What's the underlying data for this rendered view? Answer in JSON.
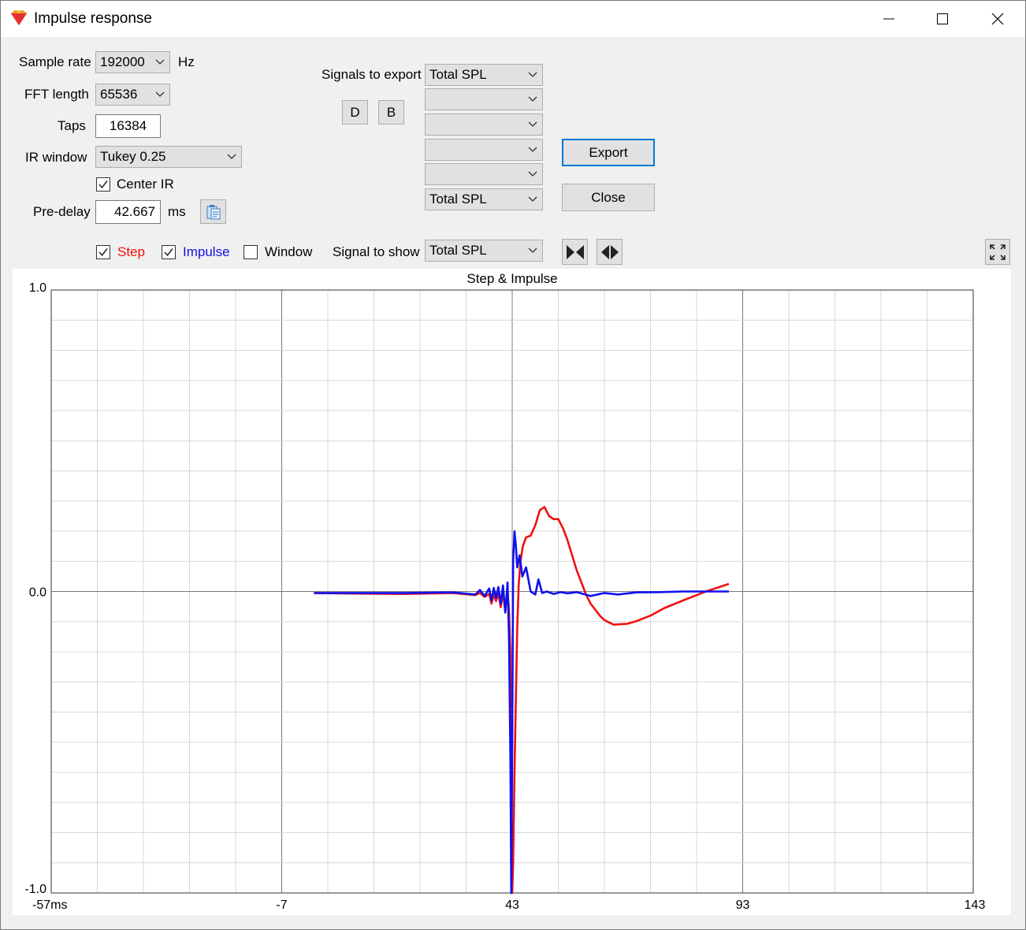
{
  "window": {
    "title": "Impulse response",
    "icon": "ruby-logo-icon"
  },
  "settings": {
    "sample_rate_label": "Sample rate",
    "sample_rate_value": "192000",
    "sample_rate_unit": "Hz",
    "fft_length_label": "FFT length",
    "fft_length_value": "65536",
    "taps_label": "Taps",
    "taps_value": "16384",
    "ir_window_label": "IR window",
    "ir_window_value": "Tukey 0.25",
    "center_ir_label": "Center IR",
    "center_ir_checked": true,
    "predelay_label": "Pre-delay",
    "predelay_value": "42.667",
    "predelay_unit": "ms"
  },
  "export": {
    "signals_label": "Signals to export",
    "signals": [
      "Total SPL",
      "",
      "",
      "",
      "",
      "Total SPL"
    ],
    "d_label": "D",
    "b_label": "B",
    "export_label": "Export",
    "close_label": "Close"
  },
  "display": {
    "step_label": "Step",
    "step_checked": true,
    "impulse_label": "Impulse",
    "impulse_checked": true,
    "window_label": "Window",
    "window_checked": false,
    "signal_show_label": "Signal to show",
    "signal_show_value": "Total SPL"
  },
  "colors": {
    "step": "#ee1111",
    "impulse": "#1010ee",
    "accent": "#0078d7"
  },
  "chart_data": {
    "type": "line",
    "title": "Step & Impulse",
    "xlabel": "",
    "ylabel": "",
    "xlim": [
      -57,
      143
    ],
    "ylim": [
      -1.0,
      1.0
    ],
    "x_tick_labels": [
      "-57ms",
      "-7",
      "43",
      "93",
      "143"
    ],
    "x_ticks": [
      -57,
      -7,
      43,
      93,
      143
    ],
    "y_tick_labels": [
      "1.0",
      "0.0",
      "-1.0"
    ],
    "y_ticks": [
      1.0,
      0.0,
      -1.0
    ],
    "grid": true,
    "series": [
      {
        "name": "Step",
        "color": "#ee1111",
        "x": [
          0.0,
          10,
          20,
          30,
          35,
          36,
          37,
          38,
          38.5,
          39,
          39.5,
          40,
          40.5,
          41,
          41.5,
          42,
          42.3,
          42.6,
          42.8,
          43.0,
          43.2,
          43.5,
          43.8,
          44.1,
          44.4,
          44.8,
          45.3,
          46,
          47,
          48,
          49,
          50,
          51,
          52,
          53,
          54,
          55,
          56,
          57,
          58,
          59,
          60,
          61,
          62,
          63,
          65,
          68,
          70,
          73,
          76,
          80,
          85,
          90
        ],
        "y": [
          -0.005,
          -0.007,
          -0.008,
          -0.005,
          -0.012,
          -0.005,
          -0.018,
          -0.008,
          -0.04,
          -0.01,
          -0.032,
          -0.005,
          -0.052,
          -0.005,
          -0.065,
          0.0,
          -0.06,
          -0.2,
          -0.6,
          -1.0,
          -0.9,
          -0.6,
          -0.35,
          -0.12,
          0.02,
          0.1,
          0.15,
          0.18,
          0.185,
          0.22,
          0.27,
          0.28,
          0.25,
          0.24,
          0.24,
          0.21,
          0.17,
          0.12,
          0.07,
          0.03,
          -0.01,
          -0.04,
          -0.06,
          -0.08,
          -0.095,
          -0.11,
          -0.107,
          -0.098,
          -0.08,
          -0.055,
          -0.03,
          0.0,
          0.025
        ]
      },
      {
        "name": "Impulse",
        "color": "#1010ee",
        "x": [
          0.0,
          10,
          20,
          30,
          35,
          36,
          37,
          38,
          38.5,
          39,
          39.5,
          40,
          40.5,
          41,
          41.5,
          42,
          42.3,
          42.6,
          42.8,
          43.0,
          43.2,
          43.5,
          43.8,
          44.1,
          44.6,
          45.2,
          46,
          47,
          48,
          48.7,
          49.5,
          50.5,
          52,
          53.5,
          55,
          57,
          60,
          63,
          66,
          70,
          75,
          80,
          85,
          90
        ],
        "y": [
          -0.005,
          -0.005,
          -0.005,
          -0.003,
          -0.01,
          0.005,
          -0.015,
          0.01,
          -0.03,
          0.012,
          -0.02,
          0.015,
          -0.04,
          0.02,
          -0.07,
          0.03,
          -0.15,
          -0.55,
          -1.0,
          -0.5,
          0.1,
          0.2,
          0.15,
          0.08,
          0.12,
          0.05,
          0.08,
          0.0,
          -0.01,
          0.04,
          -0.005,
          0.0,
          -0.008,
          -0.002,
          -0.006,
          -0.002,
          -0.015,
          -0.005,
          -0.01,
          -0.003,
          -0.002,
          0.0,
          0.0,
          0.0
        ]
      }
    ]
  }
}
